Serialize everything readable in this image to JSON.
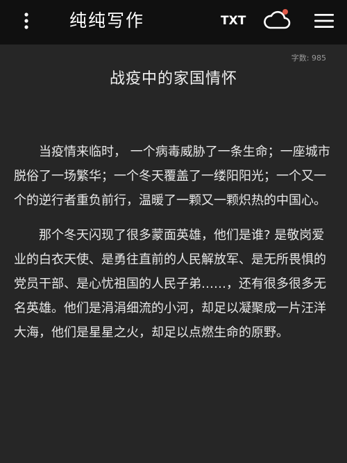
{
  "header": {
    "title": "纯纯写作",
    "txt_label": "TXT",
    "icons": {
      "menu": "more-vertical-icon",
      "cloud": "cloud-sync-icon",
      "notification_dot_color": "#e05a4a",
      "hamburger": "hamburger-menu-icon"
    }
  },
  "document": {
    "word_count_label": "字数: 985",
    "title": "战疫中的家国情怀",
    "paragraphs": [
      "当疫情来临时， 一个病毒威胁了一条生命；一座城市脱俗了一场繁华；一个冬天覆盖了一缕阳阳光；一个又一个的逆行者重负前行，温暖了一颗又一颗炽热的中国心。",
      "那个冬天闪现了很多蒙面英雄，他们是谁? 是敬岗爱业的白衣天使、是勇往直前的人民解放军、是无所畏惧的党员干部、是心忧祖国的人民子弟……，还有很多很多无名英雄。他们是涓涓细流的小河，却足以凝聚成一片汪洋大海，他们是星星之火，却足以点燃生命的原野。"
    ]
  }
}
